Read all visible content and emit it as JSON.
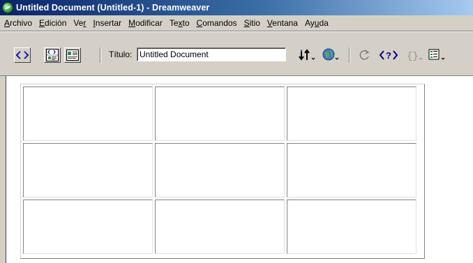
{
  "window": {
    "title": "Untitled Document (Untitled-1) - Dreamweaver"
  },
  "menubar": {
    "items": [
      {
        "mnemonic": "A",
        "rest": "rchivo"
      },
      {
        "mnemonic": "E",
        "rest": "dición"
      },
      {
        "prefix": "Ve",
        "mnemonic": "r",
        "rest": ""
      },
      {
        "mnemonic": "I",
        "rest": "nsertar"
      },
      {
        "mnemonic": "M",
        "rest": "odificar"
      },
      {
        "prefix": "Te",
        "mnemonic": "x",
        "rest": "to"
      },
      {
        "mnemonic": "C",
        "rest": "omandos"
      },
      {
        "mnemonic": "S",
        "rest": "itio"
      },
      {
        "mnemonic": "V",
        "rest": "entana"
      },
      {
        "prefix": "Ay",
        "mnemonic": "u",
        "rest": "da"
      }
    ]
  },
  "toolbar": {
    "title_label": "Título:",
    "title_value": "Untitled Document",
    "icons": [
      "code-view-icon",
      "split-view-icon",
      "design-view-icon",
      "file-management-icon",
      "preview-browser-icon",
      "refresh-icon",
      "reference-icon",
      "code-navigation-icon",
      "view-options-icon"
    ]
  },
  "document": {
    "table": {
      "rows": 3,
      "columns": 3,
      "cells": [
        [
          "",
          "",
          ""
        ],
        [
          "",
          "",
          ""
        ],
        [
          "",
          "",
          ""
        ]
      ]
    }
  }
}
